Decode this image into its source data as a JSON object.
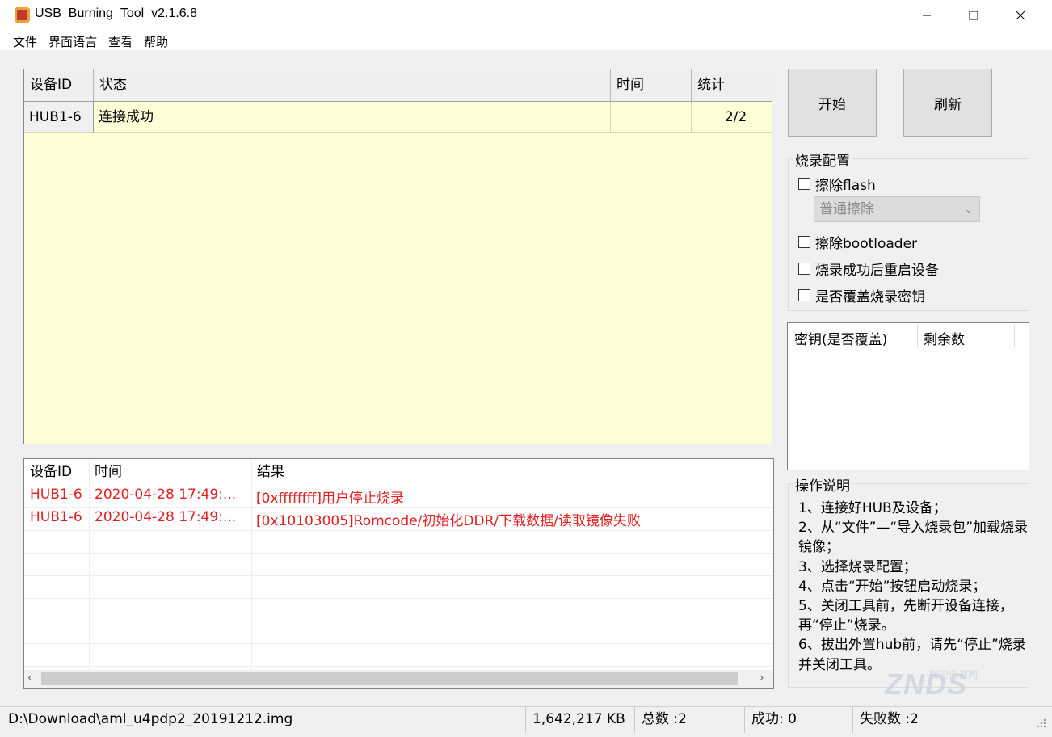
{
  "window": {
    "title": "USB_Burning_Tool_v2.1.6.8"
  },
  "menu": [
    "文件",
    "界面语言",
    "查看",
    "帮助"
  ],
  "device_table": {
    "headers": [
      "设备ID",
      "状态",
      "时间",
      "统计"
    ],
    "rows": [
      {
        "id": "HUB1-6",
        "status": "连接成功",
        "time": "",
        "count": "2/2"
      }
    ]
  },
  "buttons": {
    "start": "开始",
    "refresh": "刷新"
  },
  "config": {
    "title": "烧录配置",
    "erase_flash": "擦除flash",
    "erase_mode": "普通擦除",
    "erase_bootloader": "擦除bootloader",
    "reboot_after": "烧录成功后重启设备",
    "overwrite_key": "是否覆盖烧录密钥"
  },
  "key_list": {
    "headers": [
      "密钥(是否覆盖)",
      "剩余数"
    ]
  },
  "instructions": {
    "title": "操作说明",
    "lines": [
      "1、连接好HUB及设备；",
      "2、从“文件”—“导入烧录包”加载烧录镜像；",
      "3、选择烧录配置；",
      "4、点击“开始”按钮启动烧录；",
      "5、关闭工具前，先断开设备连接，再“停止”烧录。",
      "6、拔出外置hub前，请先“停止”烧录并关闭工具。"
    ]
  },
  "log": {
    "headers": [
      "设备ID",
      "时间",
      "结果"
    ],
    "rows": [
      {
        "id": "HUB1-6",
        "time": "2020-04-28 17:49:...",
        "result": "[0xffffffff]用户停止烧录"
      },
      {
        "id": "HUB1-6",
        "time": "2020-04-28 17:49:...",
        "result": "[0x10103005]Romcode/初始化DDR/下载数据/读取镜像失败"
      }
    ]
  },
  "status_bar": {
    "path": "D:\\Download\\aml_u4pdp2_20191212.img",
    "size": "1,642,217 KB",
    "total": "总数 :2",
    "success": "成功:  0",
    "fail": "失败数 :2"
  },
  "watermark": {
    "main": "ZNDS",
    "sub": "智能电视网"
  },
  "colors": {
    "table_bg": "#ffffd8",
    "log_error": "#e02020"
  }
}
